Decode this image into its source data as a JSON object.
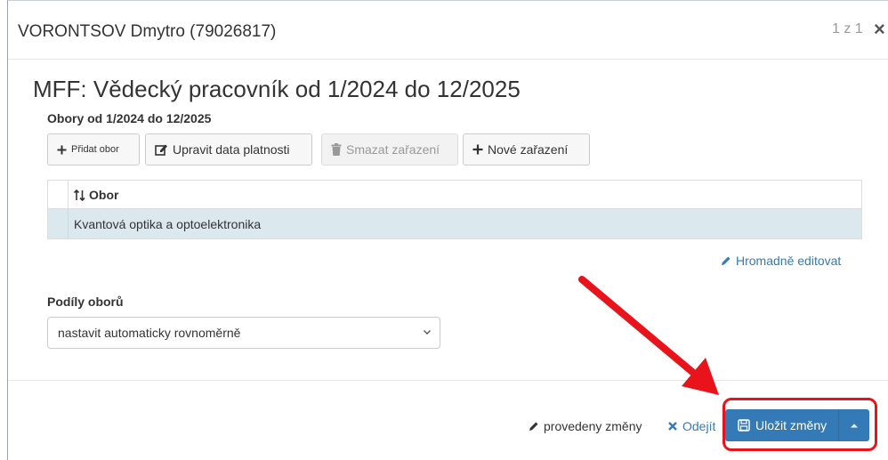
{
  "header": {
    "title": "VORONTSOV Dmytro (79026817)",
    "pager": "1 z 1",
    "close": "×"
  },
  "section": {
    "title": "MFF: Vědecký pracovník od 1/2024 do 12/2025",
    "obory_label": "Obory od 1/2024 do 12/2025"
  },
  "toolbar": {
    "add_label": "Přidat obor",
    "edit_label": "Upravit data platnosti",
    "delete_label": "Smazat zařazení",
    "new_label": "Nové zařazení"
  },
  "table": {
    "column_header": "Obor",
    "rows": [
      {
        "obor": "Kvantová optika a optoelektronika"
      }
    ]
  },
  "bulk_edit_label": "Hromadně editovat",
  "podily": {
    "label": "Podíly oborů",
    "selected": "nastavit automaticky rovnoměrně"
  },
  "footer": {
    "changes_label": "provedeny změny",
    "leave_label": "Odejít",
    "save_label": "Uložit změny"
  },
  "colors": {
    "primary": "#337ab7",
    "link": "#337ab7",
    "selected_row": "#dbe9ef",
    "annotation": "#e8131b"
  },
  "icons": {
    "add": "plus-icon",
    "edit": "edit-icon",
    "delete": "trash-icon",
    "new": "plus-icon",
    "sort": "sort-icon",
    "bulk": "pencil-icon",
    "select": "chevron-down-icon",
    "changes": "pencil-icon",
    "leave": "close-icon",
    "save": "floppy-icon",
    "save_menu": "caret-up-icon"
  }
}
